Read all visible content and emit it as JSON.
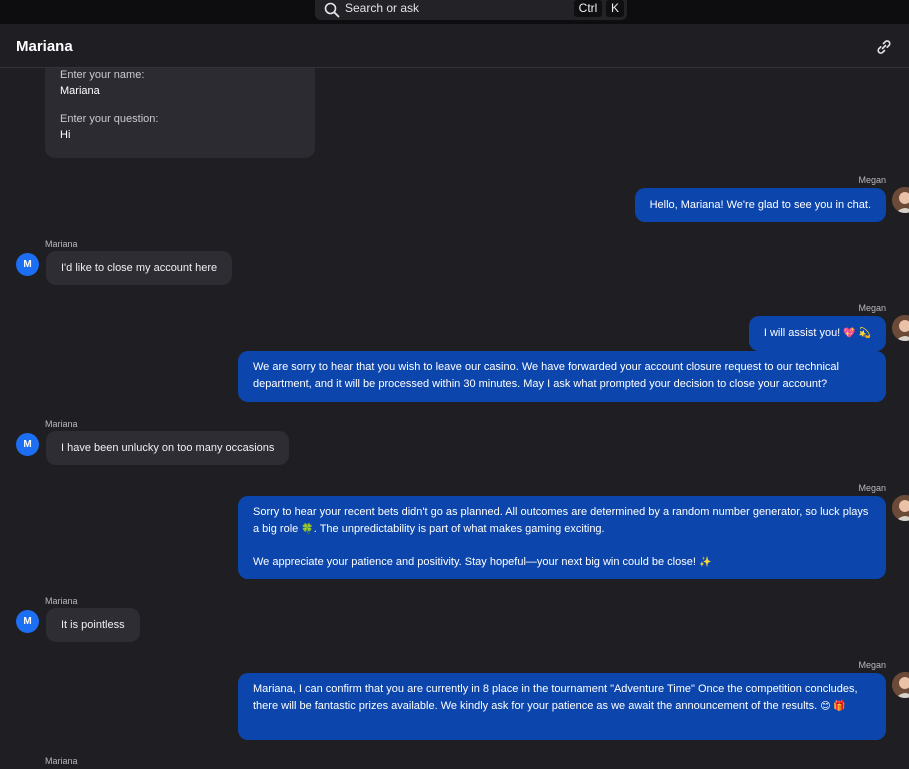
{
  "search": {
    "placeholder": "Search or ask",
    "shortcut_ctrl": "Ctrl",
    "shortcut_key": "K"
  },
  "header": {
    "title": "Mariana"
  },
  "form": {
    "name_label": "Enter your name:",
    "name_value": "Mariana",
    "question_label": "Enter your question:",
    "question_value": "Hi"
  },
  "messages": [
    {
      "sender": "Megan",
      "avatar": "photo",
      "text": "Hello, Mariana! We're glad to see you in chat."
    },
    {
      "sender": "Mariana",
      "avatar": "M",
      "text": "I'd like to close my account here"
    },
    {
      "sender": "Megan",
      "avatar": "photo",
      "text": "I will assist you!",
      "emoji": "💖 💫"
    },
    {
      "sender": "Megan",
      "text": "We are sorry to hear that you wish to leave our casino. We have forwarded your account closure request to our technical department, and it will be processed within 30 minutes. May I ask what prompted your decision to close your account?"
    },
    {
      "sender": "Mariana",
      "avatar": "M",
      "text": "I have been unlucky on too many occasions"
    },
    {
      "sender": "Megan",
      "avatar": "photo",
      "text_a": "Sorry to hear your recent bets didn't go as planned. All outcomes are determined by a random number generator, so luck plays a big role",
      "emoji_a": "🍀",
      "text_b": ". The unpredictability is part of what makes gaming exciting.",
      "text_c": "We appreciate your patience and positivity. Stay hopeful—your next big win could be close!",
      "emoji_c": "✨"
    },
    {
      "sender": "Mariana",
      "avatar": "M",
      "text": "It is pointless"
    },
    {
      "sender": "Megan",
      "avatar": "photo",
      "text": "Mariana, I can confirm that you are currently in 8 place in the tournament \"Adventure Time\" Once the competition concludes, there will be fantastic prizes available. We kindly ask for your patience as we await the announcement of the results.",
      "emoji": "😊 🎁"
    },
    {
      "sender": "Mariana"
    }
  ],
  "colors": {
    "background": "#1f1e22",
    "agent_bubble": "#0c46ad",
    "user_bubble": "#2e2d33",
    "user_avatar": "#1c6ef2"
  },
  "icons": {
    "search": "search-icon",
    "link": "link-icon"
  }
}
